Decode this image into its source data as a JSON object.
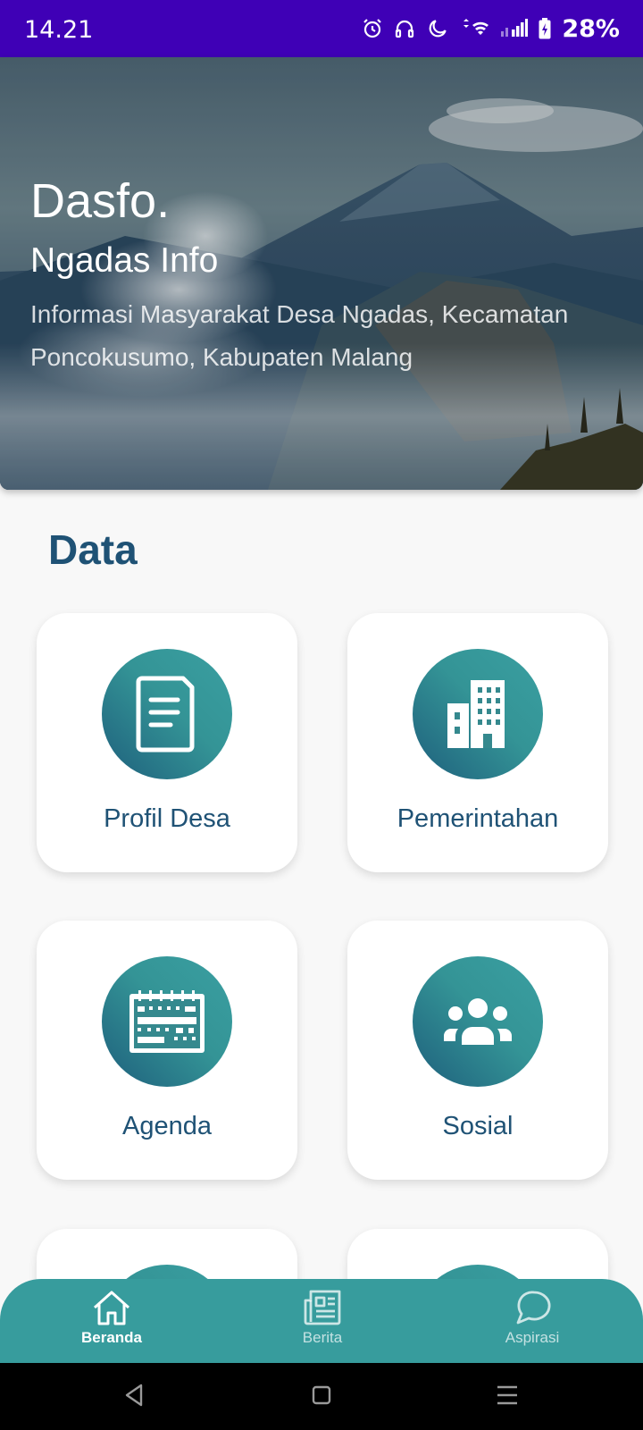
{
  "status_bar": {
    "time": "14.21",
    "battery": "28%"
  },
  "hero": {
    "title": "Dasfo.",
    "subtitle": "Ngadas Info",
    "description": "Informasi Masyarakat Desa Ngadas, Kecamatan Poncokusumo, Kabupaten Malang"
  },
  "section": {
    "title": "Data"
  },
  "cards": [
    {
      "label": "Profil Desa",
      "icon": "document-icon"
    },
    {
      "label": "Pemerintahan",
      "icon": "building-icon"
    },
    {
      "label": "Agenda",
      "icon": "calendar-icon"
    },
    {
      "label": "Sosial",
      "icon": "people-icon"
    }
  ],
  "bottom_nav": {
    "items": [
      {
        "label": "Beranda",
        "icon": "home-icon",
        "active": true
      },
      {
        "label": "Berita",
        "icon": "newspaper-icon",
        "active": false
      },
      {
        "label": "Aspirasi",
        "icon": "chat-icon",
        "active": false
      }
    ]
  },
  "colors": {
    "status_bar": "#3f00b6",
    "accent": "#379c9d",
    "heading": "#1f5275"
  }
}
